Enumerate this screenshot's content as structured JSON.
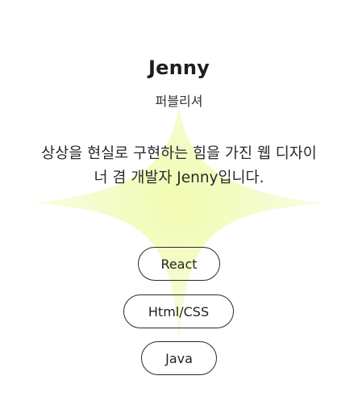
{
  "profile": {
    "name": "Jenny",
    "role": "퍼블리셔",
    "bio_line1": "상상을 현실로 구현하는 힘을 가진 웹 디자이",
    "bio_line2": "너 겸 개발자 Jenny입니다."
  },
  "skills": [
    {
      "label": "React"
    },
    {
      "label": "Html/CSS"
    },
    {
      "label": "Java"
    }
  ],
  "colors": {
    "sparkle_center": "#f4fcc0",
    "sparkle_edge": "#fafde6",
    "text": "#222222",
    "pill_border": "#2b2b2b"
  },
  "icons": {
    "background": "four-point-star-sparkle"
  }
}
